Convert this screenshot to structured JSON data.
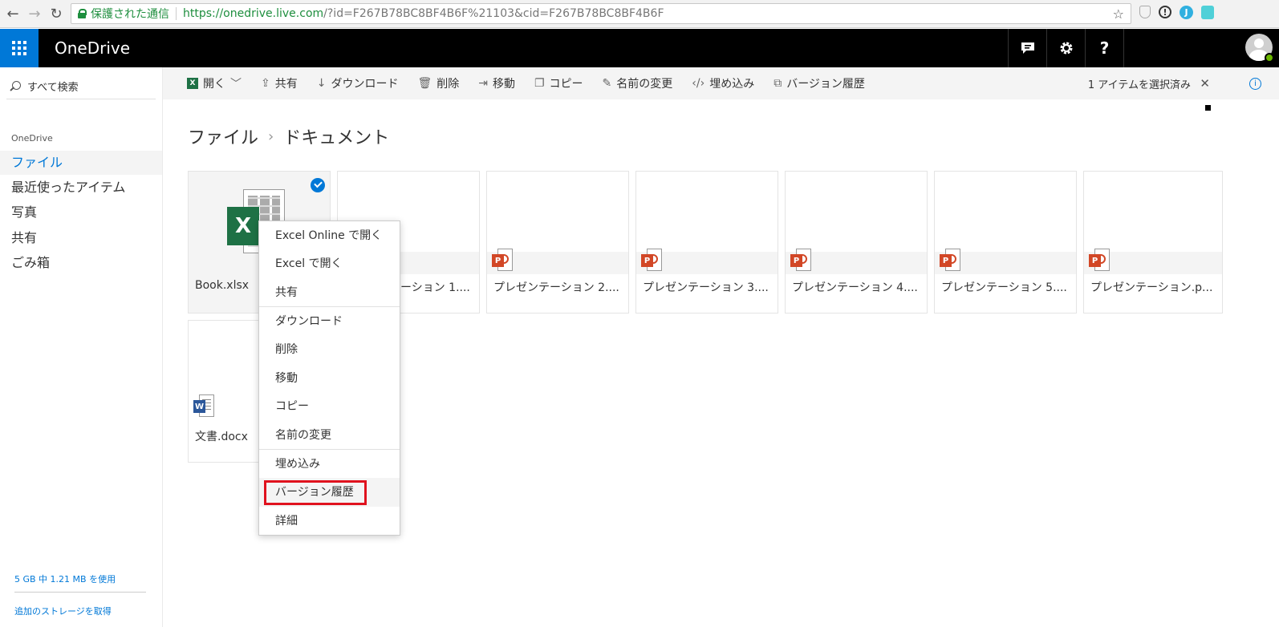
{
  "browser": {
    "secure_label": "保護された通信",
    "url_host": "https://onedrive.live.com",
    "url_rest": "/?id=F267B78BC8BF4B6F%21103&cid=F267B78BC8BF4B6F"
  },
  "suite": {
    "brand": "OneDrive",
    "help": "?"
  },
  "sidebar": {
    "search_placeholder": "すべて検索",
    "section": "OneDrive",
    "items": [
      "ファイル",
      "最近使ったアイテム",
      "写真",
      "共有",
      "ごみ箱"
    ],
    "quota": "5 GB 中 1.21 MB を使用",
    "get_storage": "追加のストレージを取得"
  },
  "commands": {
    "open": "開く",
    "share": "共有",
    "download": "ダウンロード",
    "delete": "削除",
    "move": "移動",
    "copy": "コピー",
    "rename": "名前の変更",
    "embed": "埋め込み",
    "version_history": "バージョン履歴",
    "selected": "1 アイテムを選択済み"
  },
  "breadcrumb": [
    "ファイル",
    "ドキュメント"
  ],
  "files": [
    {
      "name": "Book.xlsx",
      "type": "excel",
      "selected": true
    },
    {
      "name": "プレゼンテーション 1....",
      "type": "powerpoint"
    },
    {
      "name": "プレゼンテーション 2....",
      "type": "powerpoint"
    },
    {
      "name": "プレゼンテーション 3....",
      "type": "powerpoint"
    },
    {
      "name": "プレゼンテーション 4....",
      "type": "powerpoint"
    },
    {
      "name": "プレゼンテーション 5....",
      "type": "powerpoint"
    },
    {
      "name": "プレゼンテーション.p...",
      "type": "powerpoint"
    },
    {
      "name": "文書.docx",
      "type": "word"
    }
  ],
  "context_menu": [
    "Excel Online で開く",
    "Excel で開く",
    "共有",
    "ダウンロード",
    "削除",
    "移動",
    "コピー",
    "名前の変更",
    "埋め込み",
    "バージョン履歴",
    "詳細"
  ],
  "colors": {
    "accent": "#0078d7",
    "excel": "#1e7145",
    "powerpoint": "#d24726",
    "word": "#2b579a",
    "highlight": "#e0121e"
  }
}
